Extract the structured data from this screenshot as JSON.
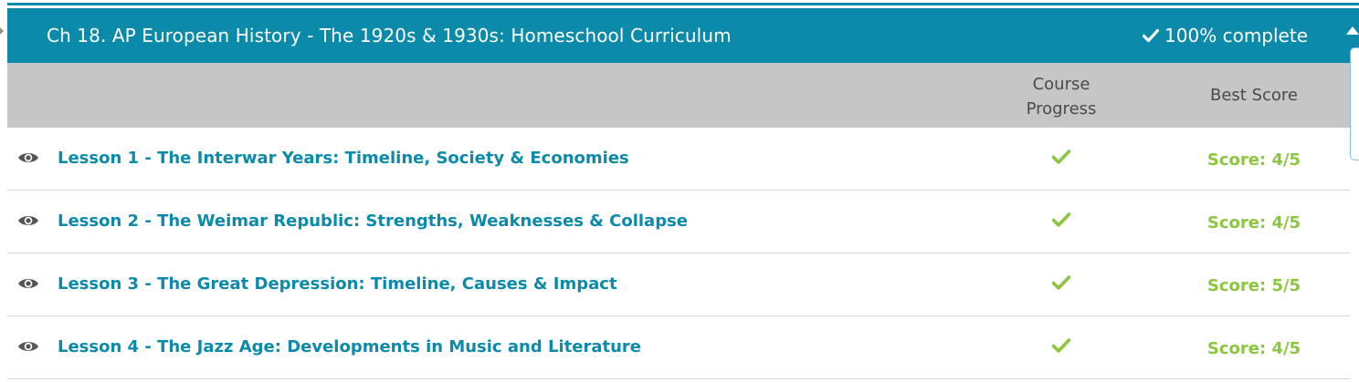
{
  "chapter": {
    "title": "Ch 18. AP European History - The 1920s & 1930s: Homeschool Curriculum",
    "completion": "100% complete"
  },
  "table": {
    "columns": {
      "progress_line1": "Course",
      "progress_line2": "Progress",
      "score": "Best Score"
    },
    "rows": [
      {
        "title": "Lesson 1 - The Interwar Years: Timeline, Society & Economies",
        "completed": true,
        "score": "Score: 4/5"
      },
      {
        "title": "Lesson 2 - The Weimar Republic: Strengths, Weaknesses & Collapse",
        "completed": true,
        "score": "Score: 4/5"
      },
      {
        "title": "Lesson 3 - The Great Depression: Timeline, Causes & Impact",
        "completed": true,
        "score": "Score: 5/5"
      },
      {
        "title": "Lesson 4 - The Jazz Age: Developments in Music and Literature",
        "completed": true,
        "score": "Score: 4/5"
      }
    ]
  },
  "icons": {
    "row_icon": "eye-icon",
    "progress_icon": "checkmark-icon",
    "header_icon": "checkmark-icon",
    "collapse_icon": "caret-up-icon"
  },
  "colors": {
    "header_bg": "#0b8aaa",
    "table_header_bg": "#c6c6c6",
    "link": "#0b8aaa",
    "success": "#8cc63f"
  }
}
